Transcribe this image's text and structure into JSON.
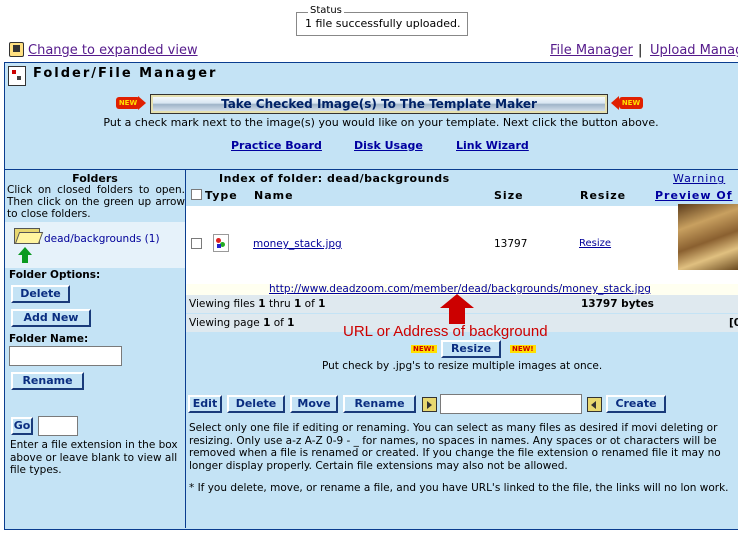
{
  "status": {
    "legend": "Status",
    "message": "1 file successfully uploaded."
  },
  "topnav": {
    "expanded_view": "Change to expanded view",
    "file_manager": "File Manager",
    "separator": "|",
    "upload_manager": "Upload Manag"
  },
  "header": {
    "title": "Folder/File Manager",
    "big_button": "Take Checked Image(s) To The Template Maker",
    "new_badge": "NEW",
    "instructions": "Put a check mark next to the image(s) you would like on your template. Next click the button above.",
    "links": [
      "Practice Board",
      "Disk Usage",
      "Link Wizard"
    ]
  },
  "sidebar": {
    "heading": "Folders",
    "help": "Click on closed folders to open. Then click on the green up arrow to close folders.",
    "folder": "dead/backgrounds (1)",
    "options_label": "Folder Options:",
    "delete_btn": "Delete",
    "add_new_btn": "Add New",
    "name_label": "Folder Name:",
    "rename_btn": "Rename",
    "go_btn": "Go",
    "ext_help": "Enter a file extension in the box above or leave blank to view all file types."
  },
  "main": {
    "index_title": "Index of folder: dead/backgrounds",
    "warning": "Warning",
    "columns": {
      "type": "Type",
      "name": "Name",
      "size": "Size",
      "resize": "Resize",
      "preview": "Preview Of"
    },
    "file": {
      "name": "money_stack.jpg",
      "size": "13797",
      "resize": "Resize"
    },
    "url": "http://www.deadzoom.com/member/dead/backgrounds/money_stack.jpg",
    "viewing_files": [
      "Viewing files ",
      "1",
      " thru ",
      "1",
      " of ",
      "1"
    ],
    "total_bytes": "13797 bytes",
    "viewing_page": [
      "Viewing page ",
      "1",
      " of ",
      "1"
    ],
    "annotation": "URL or Address of background",
    "resize_btn": "Resize",
    "new_small": "NEW!",
    "resize_help": "Put check by .jpg's to resize multiple images at once.",
    "actions": [
      "Edit",
      "Delete",
      "Move",
      "Rename"
    ],
    "create_btn": "Create",
    "help1": "Select only one file if editing or renaming. You can select as many files as desired if movi deleting or resizing. Only use a-z A-Z 0-9 - _ for names, no spaces in names. Any spaces or ot characters will be removed when a file is renamed or created. If you change the file extension o renamed file it may no longer display properly. Certain file extensions may also not be allowed.",
    "help2": "* If you delete, move, or rename a file, and you have URL's linked to the file, the links will no lon work.",
    "edge_char": "[0"
  },
  "colors": {
    "panel": "#c4e3f5",
    "border": "#0a3d8f",
    "link": "#0000a0",
    "annotation": "#cc0000"
  }
}
